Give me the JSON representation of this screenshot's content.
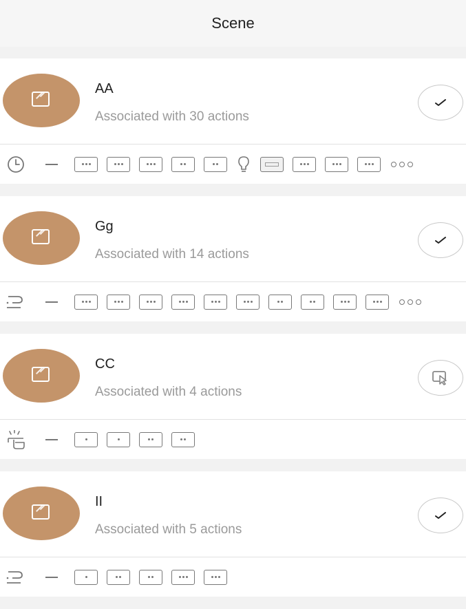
{
  "header": {
    "title": "Scene"
  },
  "scenes": [
    {
      "name": "AA",
      "subtitle": "Associated with 30 actions",
      "status_icon": "checkmark-icon",
      "trigger_icon": "clock-icon",
      "actions": [
        "dots3",
        "dots3",
        "dots3",
        "dots2",
        "dots2",
        "bulb",
        "wide",
        "dots3",
        "dots3",
        "dots3"
      ],
      "more": true
    },
    {
      "name": "Gg",
      "subtitle": "Associated with 14 actions",
      "status_icon": "checkmark-icon",
      "trigger_icon": "list-condition-icon",
      "actions": [
        "dots3",
        "dots3",
        "dots3",
        "dots3",
        "dots3",
        "dots3",
        "dots2",
        "dots2",
        "dots3",
        "dots3"
      ],
      "more": true
    },
    {
      "name": "CC",
      "subtitle": "Associated with 4 actions",
      "status_icon": "tap-cursor-icon",
      "trigger_icon": "hand-tap-icon",
      "actions": [
        "dots1",
        "dots1",
        "dots2",
        "dots2"
      ],
      "more": false
    },
    {
      "name": "II",
      "subtitle": "Associated with 5 actions",
      "status_icon": "checkmark-icon",
      "trigger_icon": "list-condition-icon",
      "actions": [
        "dots1",
        "dots2",
        "dots2",
        "dots3",
        "dots3"
      ],
      "more": false
    }
  ],
  "colors": {
    "avatar": "#c4946a",
    "background": "#f2f2f2",
    "card": "#ffffff",
    "subtext": "#9a9a9a",
    "icon": "#777777"
  }
}
